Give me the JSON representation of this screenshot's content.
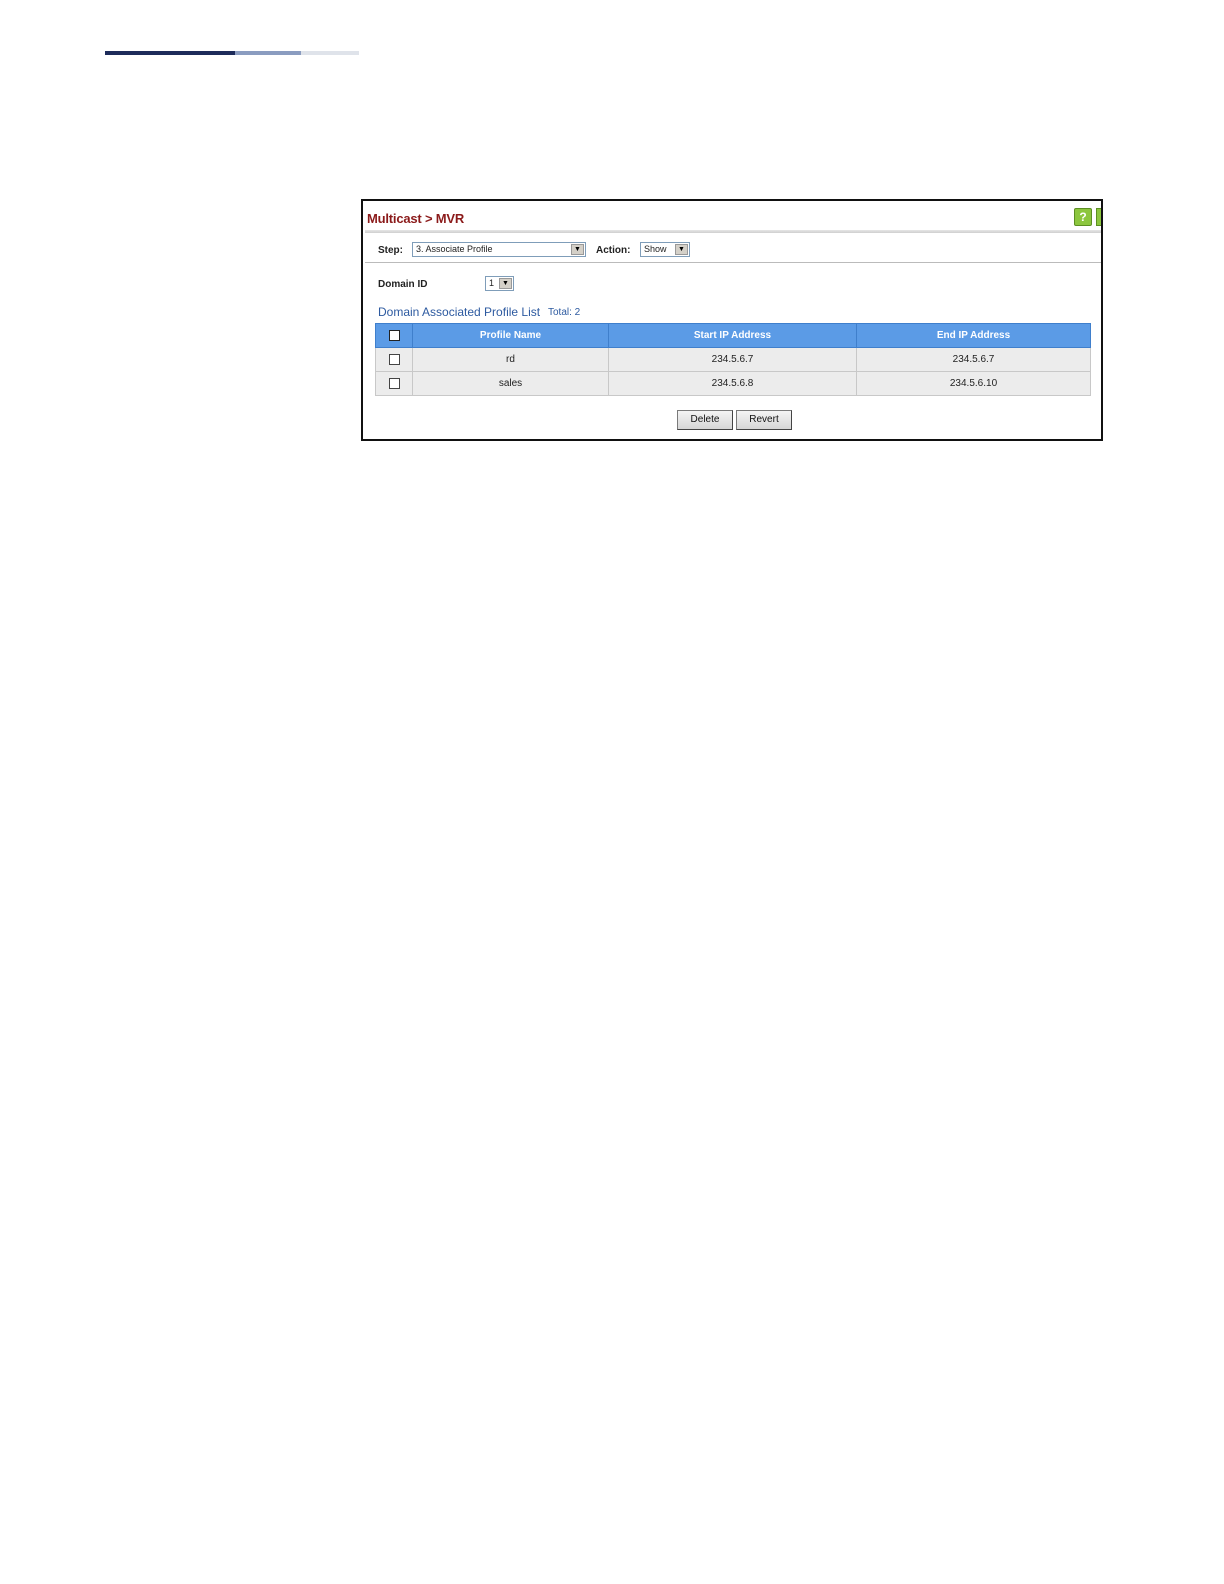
{
  "page": {
    "title": "Multicast > MVR"
  },
  "step": {
    "label": "Step:",
    "value": "3. Associate Profile"
  },
  "action": {
    "label": "Action:",
    "value": "Show"
  },
  "domain": {
    "label": "Domain ID",
    "value": "1"
  },
  "list": {
    "title": "Domain Associated Profile List",
    "total": "Total: 2",
    "columns": [
      "Profile Name",
      "Start IP Address",
      "End IP Address"
    ],
    "rows": [
      {
        "profile": "rd",
        "start_ip": "234.5.6.7",
        "end_ip": "234.5.6.7"
      },
      {
        "profile": "sales",
        "start_ip": "234.5.6.8",
        "end_ip": "234.5.6.10"
      }
    ]
  },
  "buttons": {
    "delete": "Delete",
    "revert": "Revert"
  },
  "icons": {
    "help": "help-icon"
  },
  "colors": {
    "title": "#8b1a1a",
    "header": "#5b9be6",
    "link": "#2d5aa0"
  }
}
